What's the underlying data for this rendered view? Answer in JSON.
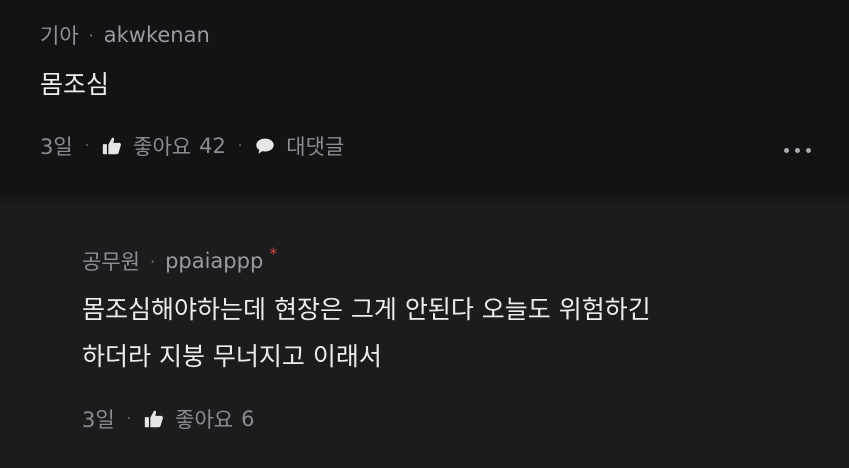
{
  "comments": [
    {
      "category": "기아",
      "username": "akwkenan",
      "body_lines": [
        "몸조심"
      ],
      "time": "3일",
      "like_label": "좋아요",
      "like_count": "42",
      "reply_label": "대댓글"
    },
    {
      "category": "공무원",
      "username": "ppaiappp",
      "author_badge": "*",
      "body_lines": [
        "몸조심해야하는데 현장은 그게 안된다 오늘도 위험하긴",
        "하더라 지붕 무너지고 이래서"
      ],
      "time": "3일",
      "like_label": "좋아요",
      "like_count": "6"
    }
  ],
  "separator": "·",
  "colors": {
    "background": "#131315",
    "reply_background": "#1c1c1f",
    "author_badge": "#d3413f"
  },
  "icons": [
    "thumbs-up-icon",
    "speech-bubble-icon",
    "more-options-icon"
  ]
}
